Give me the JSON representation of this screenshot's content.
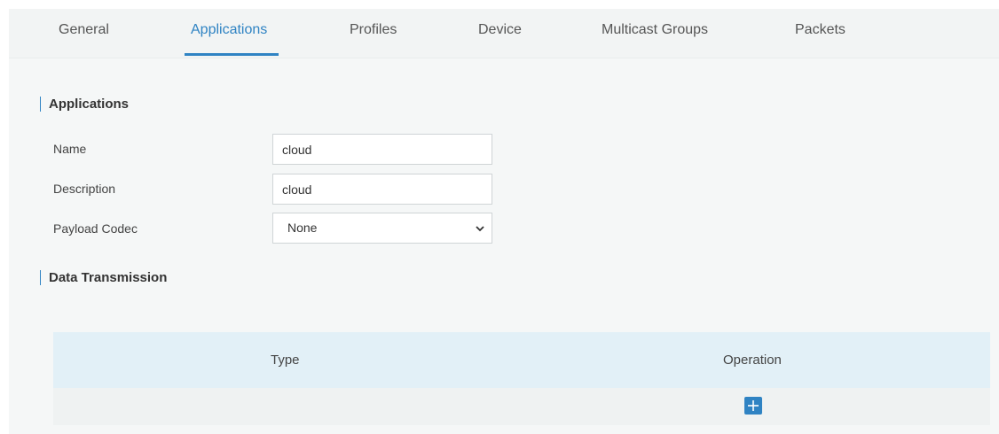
{
  "tabs": [
    {
      "label": "General",
      "active": false
    },
    {
      "label": "Applications",
      "active": true
    },
    {
      "label": "Profiles",
      "active": false
    },
    {
      "label": "Device",
      "active": false
    },
    {
      "label": "Multicast Groups",
      "active": false
    },
    {
      "label": "Packets",
      "active": false
    }
  ],
  "applications_section": {
    "title": "Applications",
    "name_label": "Name",
    "name_value": "cloud",
    "description_label": "Description",
    "description_value": "cloud",
    "payload_codec_label": "Payload Codec",
    "payload_codec_value": "None"
  },
  "data_transmission_section": {
    "title": "Data Transmission",
    "table": {
      "columns": [
        "Type",
        "Operation"
      ],
      "rows": []
    }
  },
  "colors": {
    "accent": "#2f83c3",
    "table_header_bg": "#e2f0f7",
    "page_bg": "#f5f7f7"
  },
  "icons": {
    "add": "plus-icon",
    "select_caret": "chevron-down-icon"
  }
}
